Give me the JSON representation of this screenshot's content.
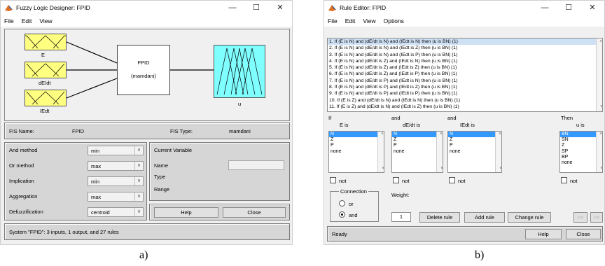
{
  "windowA": {
    "title": "Fuzzy Logic Designer: FPID",
    "menu": [
      "File",
      "Edit",
      "View"
    ],
    "inputs": [
      "E",
      "dE/dt",
      "IEdt"
    ],
    "system": {
      "name": "FPID",
      "type": "(mamdani)"
    },
    "output": "u",
    "fis_name_label": "FIS Name:",
    "fis_name_value": "FPID",
    "fis_type_label": "FIS Type:",
    "fis_type_value": "mamdani",
    "methods": [
      {
        "label": "And method",
        "value": "min"
      },
      {
        "label": "Or method",
        "value": "max"
      },
      {
        "label": "Implication",
        "value": "min"
      },
      {
        "label": "Aggregation",
        "value": "max"
      },
      {
        "label": "Defuzzification",
        "value": "centroid"
      }
    ],
    "current_variable": {
      "title": "Current Variable",
      "name_label": "Name",
      "type_label": "Type",
      "range_label": "Range"
    },
    "help": "Help",
    "close": "Close",
    "status": "System \"FPID\": 3 inputs, 1 output, and 27 rules"
  },
  "windowB": {
    "title": "Rule Editor: FPID",
    "menu": [
      "File",
      "Edit",
      "View",
      "Options"
    ],
    "rules": [
      "1. If (E is N) and (dE/dt is N) and (IEdt is N) then (u is BN) (1)",
      "2. If (E is N) and (dE/dt is N) and (IEdt is Z) then (u is BN) (1)",
      "3. If (E is N) and (dE/dt is N) and (IEdt is P) then (u is BN) (1)",
      "4. If (E is N) and (dE/dt is Z) and (IEdt is N) then (u is BN) (1)",
      "5. If (E is N) and (dE/dt is Z) and (IEdt is Z) then (u is BN) (1)",
      "6. If (E is N) and (dE/dt is Z) and (IEdt is P) then (u is BN) (1)",
      "7. If (E is N) and (dE/dt is P) and (IEdt is N) then (u is BN) (1)",
      "8. If (E is N) and (dE/dt is P) and (IEdt is Z) then (u is BN) (1)",
      "9. If (E is N) and (dE/dt is P) and (IEdt is P) then (u is BN) (1)",
      "10. If (E is Z) and (dE/dt is N) and (IEdt is N) then (u is BN) (1)",
      "11. If (E is Z) and (dE/dt is N) and (IEdt is Z) then (u is BN) (1)"
    ],
    "headers": [
      "If",
      "and",
      "and",
      "Then"
    ],
    "var_labels": [
      "E is",
      "dE/dt is",
      "IEdt is",
      "u is"
    ],
    "input_options": [
      "N",
      "Z",
      "P",
      "none"
    ],
    "output_options": [
      "BN",
      "SN",
      "Z",
      "SP",
      "BP",
      "none"
    ],
    "not_label": "not",
    "connection_label": "Connection",
    "or_label": "or",
    "and_label": "and",
    "weight_label": "Weight:",
    "weight_value": "1",
    "delete_rule": "Delete rule",
    "add_rule": "Add rule",
    "change_rule": "Change rule",
    "prev": "<<",
    "next": ">>",
    "status": "Ready",
    "help": "Help",
    "close": "Close"
  },
  "captions": {
    "a": "a)",
    "b": "b)"
  }
}
